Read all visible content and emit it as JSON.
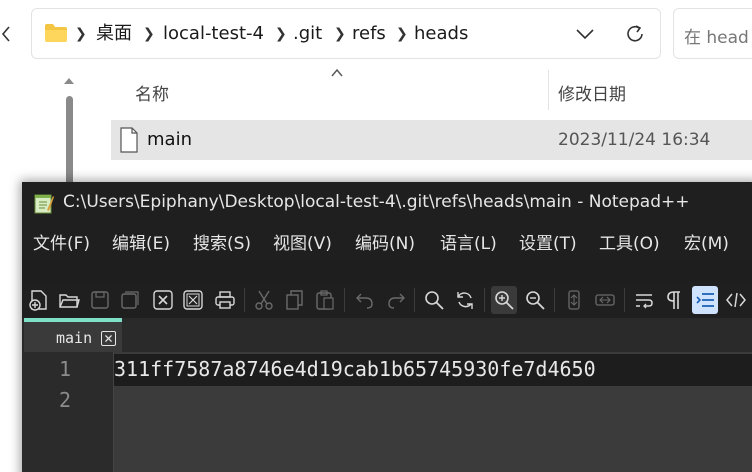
{
  "explorer": {
    "breadcrumbs": [
      "桌面",
      "local-test-4",
      ".git",
      "refs",
      "heads"
    ],
    "search_placeholder": "在 head",
    "columns": {
      "name": "名称",
      "date": "修改日期"
    },
    "files": [
      {
        "name": "main",
        "modified": "2023/11/24 16:34"
      }
    ]
  },
  "notepad": {
    "title": "C:\\Users\\Epiphany\\Desktop\\local-test-4\\.git\\refs\\heads\\main - Notepad++",
    "menu": [
      "文件(F)",
      "编辑(E)",
      "搜索(S)",
      "视图(V)",
      "编码(N)",
      "语言(L)",
      "设置(T)",
      "工具(O)",
      "宏(M)"
    ],
    "tab": {
      "label": "main"
    },
    "lines": [
      {
        "number": "1",
        "text": "311ff7587a8746e4d19cab1b65745930fe7d4650"
      },
      {
        "number": "2",
        "text": ""
      }
    ]
  },
  "icons": {
    "folder": "folder-icon",
    "file": "file-icon",
    "refresh": "refresh-icon",
    "dropdown": "chevron-down-icon",
    "app": "notepadpp-icon"
  },
  "colors": {
    "tab_accent": "#7fe0c8",
    "selected_row": "#e5e5e5",
    "npp_background": "#1e1e1e",
    "editor_background": "#3b3b3b"
  }
}
